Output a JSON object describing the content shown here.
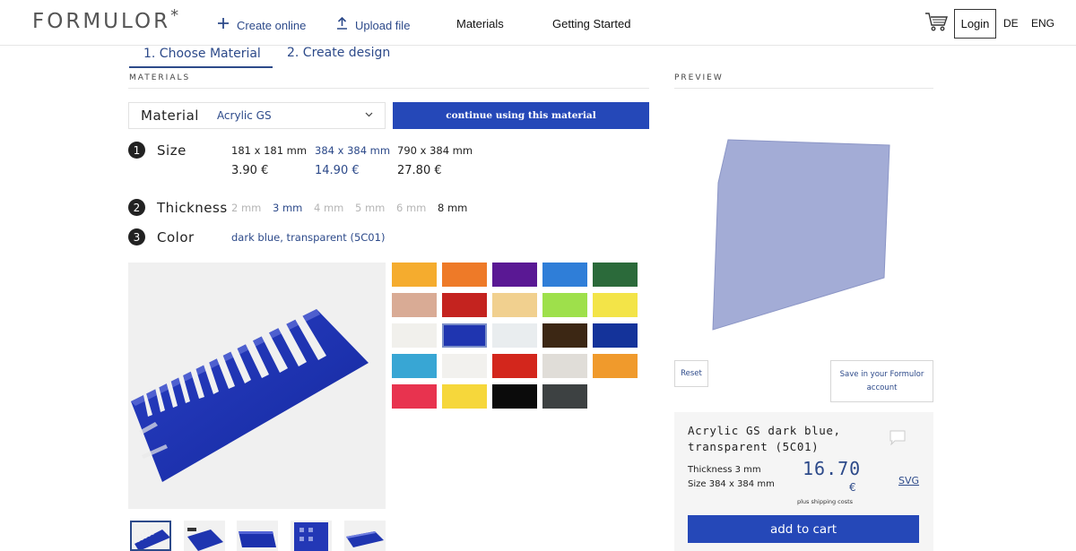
{
  "header": {
    "logo": "FORMULOR",
    "logo_star": "*",
    "create_online": "Create online",
    "upload_file": "Upload file",
    "materials": "Materials",
    "getting_started": "Getting Started",
    "login": "Login",
    "lang_de": "DE",
    "lang_eng": "ENG"
  },
  "tabs": [
    {
      "label": "1. Choose Material",
      "active": true
    },
    {
      "label": "2. Create design",
      "active": false
    }
  ],
  "sections": {
    "materials": "MATERIALS",
    "preview": "PREVIEW"
  },
  "material": {
    "label": "Material",
    "value": "Acrylic GS",
    "continue_label": "continue using this material"
  },
  "steps": {
    "size": {
      "number": "1",
      "title": "Size",
      "options": [
        {
          "label": "181 x 181 mm",
          "price": "3.90 €",
          "selected": false
        },
        {
          "label": "384 x 384 mm",
          "price": "14.90 €",
          "selected": true
        },
        {
          "label": "790 x 384 mm",
          "price": "27.80 €",
          "selected": false
        }
      ]
    },
    "thickness": {
      "number": "2",
      "title": "Thickness",
      "options": [
        {
          "label": "2 mm",
          "state": "disabled"
        },
        {
          "label": "3 mm",
          "state": "selected"
        },
        {
          "label": "4 mm",
          "state": "disabled"
        },
        {
          "label": "5 mm",
          "state": "disabled"
        },
        {
          "label": "6 mm",
          "state": "disabled"
        },
        {
          "label": "8 mm",
          "state": "available"
        }
      ]
    },
    "color": {
      "number": "3",
      "title": "Color",
      "selected_name": "dark blue, transparent (5C01)"
    }
  },
  "swatches": [
    [
      "#f5ac2e",
      "#ee7a28",
      "#5a1894",
      "#2f7ed8",
      "#2b6a3a"
    ],
    [
      "#d9ab95",
      "#c4231f",
      "#f1d08f",
      "#9ee04b",
      "#f3e448"
    ],
    [
      "#f1f0ec",
      "#1f35b0",
      "#e9edef",
      "#3c2714",
      "#14339a"
    ],
    [
      "#38a6d4",
      "#f2f1ee",
      "#d3261c",
      "#e0ddd8",
      "#f09a2c"
    ],
    [
      "#e8334f",
      "#f6d73b",
      "#0b0b0b",
      "#3d4142",
      null
    ]
  ],
  "selected_swatch": "2-1",
  "preview": {
    "reset": "Reset",
    "save": "Save in your Formulor account",
    "fill_color": "#a3acd6"
  },
  "summary": {
    "title": "Acrylic GS dark blue, transparent (5C01)",
    "thickness": "Thickness 3 mm",
    "size": "Size 384 x 384 mm",
    "price": "16.70",
    "currency": "€",
    "shipping": "plus shipping costs",
    "svg_link": "SVG",
    "add_to_cart": "add to cart"
  },
  "colors": {
    "accent": "#2548b8",
    "link": "#2d4a8a",
    "acrylic_blue": "#1f35b0"
  }
}
